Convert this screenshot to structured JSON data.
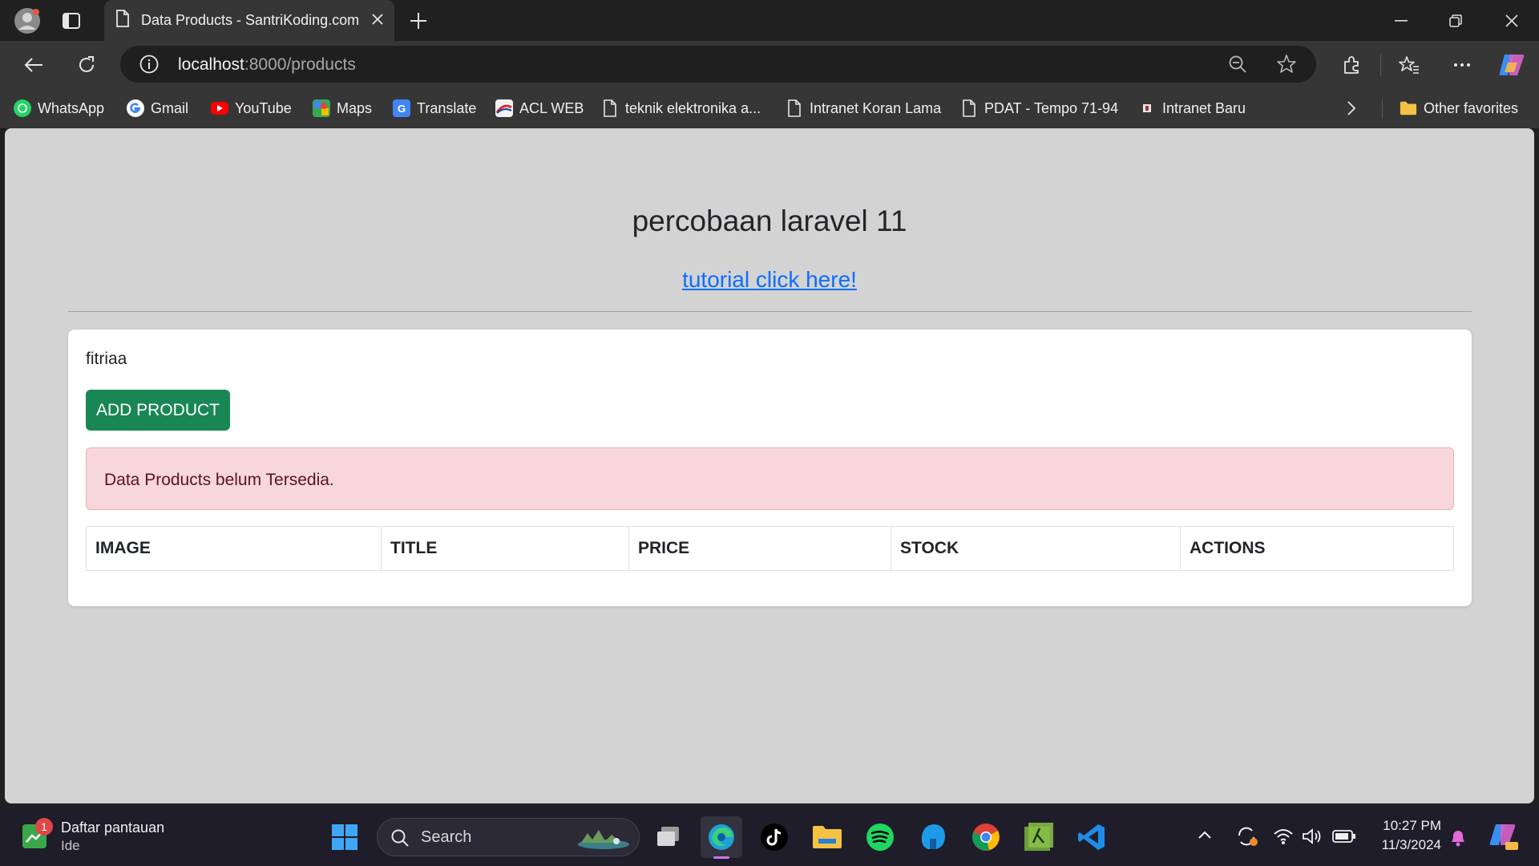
{
  "browser": {
    "active_tab_title": "Data Products - SantriKoding.com",
    "url_host": "localhost",
    "url_path": ":8000/products"
  },
  "bookmarks": [
    {
      "label": "WhatsApp",
      "icon": "whatsapp-icon"
    },
    {
      "label": "Gmail",
      "icon": "gmail-icon"
    },
    {
      "label": "YouTube",
      "icon": "youtube-icon"
    },
    {
      "label": "Maps",
      "icon": "maps-icon"
    },
    {
      "label": "Translate",
      "icon": "translate-icon"
    },
    {
      "label": "ACL WEB",
      "icon": "acl-web-icon"
    },
    {
      "label": "teknik elektronika a...",
      "icon": "page-icon"
    },
    {
      "label": "Intranet Koran Lama",
      "icon": "page-icon"
    },
    {
      "label": "PDAT - Tempo 71-94",
      "icon": "page-icon"
    },
    {
      "label": "Intranet Baru",
      "icon": "intranet-icon"
    }
  ],
  "other_favorites": "Other favorites",
  "page": {
    "heading": "percobaan laravel 11",
    "tutorial_link": "tutorial click here!",
    "username": "fitriaa",
    "add_button": "ADD PRODUCT",
    "alert": "Data Products belum Tersedia.",
    "table_headers": [
      "IMAGE",
      "TITLE",
      "PRICE",
      "STOCK",
      "ACTIONS"
    ]
  },
  "taskbar": {
    "widget_title": "Daftar pantauan",
    "widget_subtitle": "Ide",
    "widget_badge": "1",
    "search_placeholder": "Search",
    "time": "10:27 PM",
    "date": "11/3/2024"
  },
  "colors": {
    "success": "#198754",
    "link": "#0d6efd",
    "alert_bg": "#f8d7da",
    "page_bg": "#d3d3d3"
  }
}
